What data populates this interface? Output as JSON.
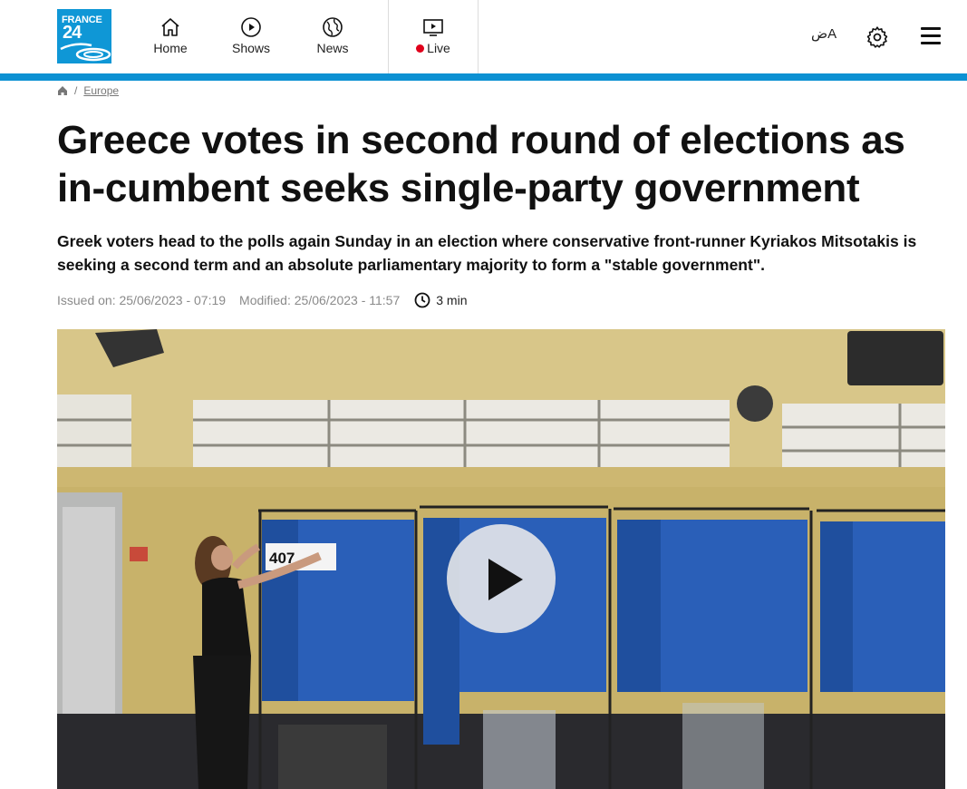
{
  "header": {
    "logo": {
      "line1": "FRANCE",
      "line2": "24"
    },
    "nav": {
      "home": "Home",
      "shows": "Shows",
      "news": "News",
      "live": "Live"
    },
    "lang_label": "ضA",
    "icons": [
      "home-icon",
      "play-circle-icon",
      "globe-icon",
      "tv-icon",
      "language-icon",
      "gear-icon",
      "menu-icon"
    ],
    "colors": {
      "accent": "#0c91d3",
      "live": "#e0001b"
    }
  },
  "breadcrumb": {
    "section": "Europe"
  },
  "article": {
    "title": "Greece votes in second round of elections as in-cumbent seeks single-party government",
    "lead": "Greek voters head to the polls again Sunday in an election where conservative front-runner Kyriakos Mitsotakis is seeking a second term and an absolute parliamentary majority to form a \"stable government\".",
    "issued": "Issued on: 25/06/2023 - 07:19",
    "modified": "Modified: 25/06/2023 - 11:57",
    "read_time": "3 min"
  },
  "media": {
    "booth_sign": "407"
  }
}
